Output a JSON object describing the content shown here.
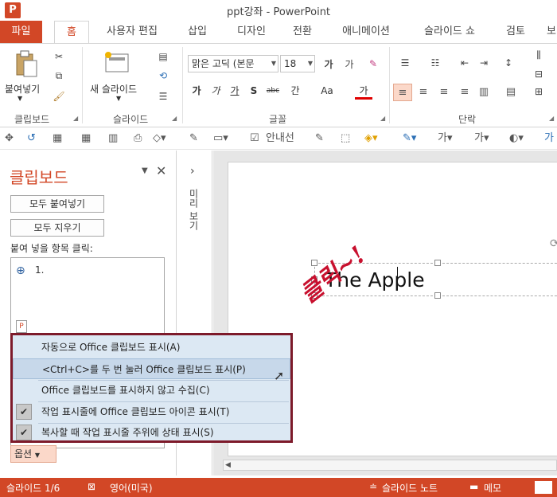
{
  "window": {
    "app_icon": "P",
    "title": "ppt강좌 - PowerPoint"
  },
  "tabs": [
    {
      "label": "파일"
    },
    {
      "label": "홈"
    },
    {
      "label": "사용자 편집"
    },
    {
      "label": "삽입"
    },
    {
      "label": "디자인"
    },
    {
      "label": "전환"
    },
    {
      "label": "애니메이션"
    },
    {
      "label": "슬라이드 쇼"
    },
    {
      "label": "검토"
    },
    {
      "label": "보"
    }
  ],
  "ribbon": {
    "clipboard": {
      "paste": "붙여넣기",
      "group": "클립보드"
    },
    "slides": {
      "new_slide": "새 슬라이드",
      "group": "슬라이드"
    },
    "font": {
      "font_name": "맑은 고딕 (본문",
      "font_size": "18",
      "group": "글꼴",
      "bold": "가",
      "italic": "가",
      "underline": "가",
      "shadow": "S",
      "strike": "abc",
      "spacing": "간",
      "case": "Aa",
      "color": "가",
      "grow": "가",
      "shrink": "가"
    },
    "paragraph": {
      "group": "단락"
    }
  },
  "clipboard_pane": {
    "title": "클립보드",
    "paste_all": "모두 붙여넣기",
    "clear_all": "모두 지우기",
    "hint": "붙여 넣을 항목 클릭:",
    "item1": "1.",
    "options": "옵션"
  },
  "thumbnails": {
    "label": "미리 보기"
  },
  "slide": {
    "text": "The Apple"
  },
  "annotation": "클릭~!",
  "menu": {
    "items": [
      {
        "label": "자동으로 Office 클립보드 표시(A)",
        "checked": false
      },
      {
        "label": "<Ctrl+C>를 두 번 눌러 Office 클립보드 표시(P)",
        "checked": false
      },
      {
        "label": "Office 클립보드를 표시하지 않고 수집(C)",
        "checked": false
      },
      {
        "label": "작업 표시줄에 Office 클립보드 아이콘 표시(T)",
        "checked": true
      },
      {
        "label": "복사할 때 작업 표시줄 주위에 상태 표시(S)",
        "checked": true
      }
    ]
  },
  "statusbar": {
    "slide": "슬라이드 1/6",
    "language": "영어(미국)",
    "notes": "슬라이드 노트",
    "comments": "메모"
  },
  "colors": {
    "accent": "#d24726",
    "menu_border": "#7d1a2a",
    "menu_bg": "#dce8f3",
    "annotation": "#c8102e"
  }
}
